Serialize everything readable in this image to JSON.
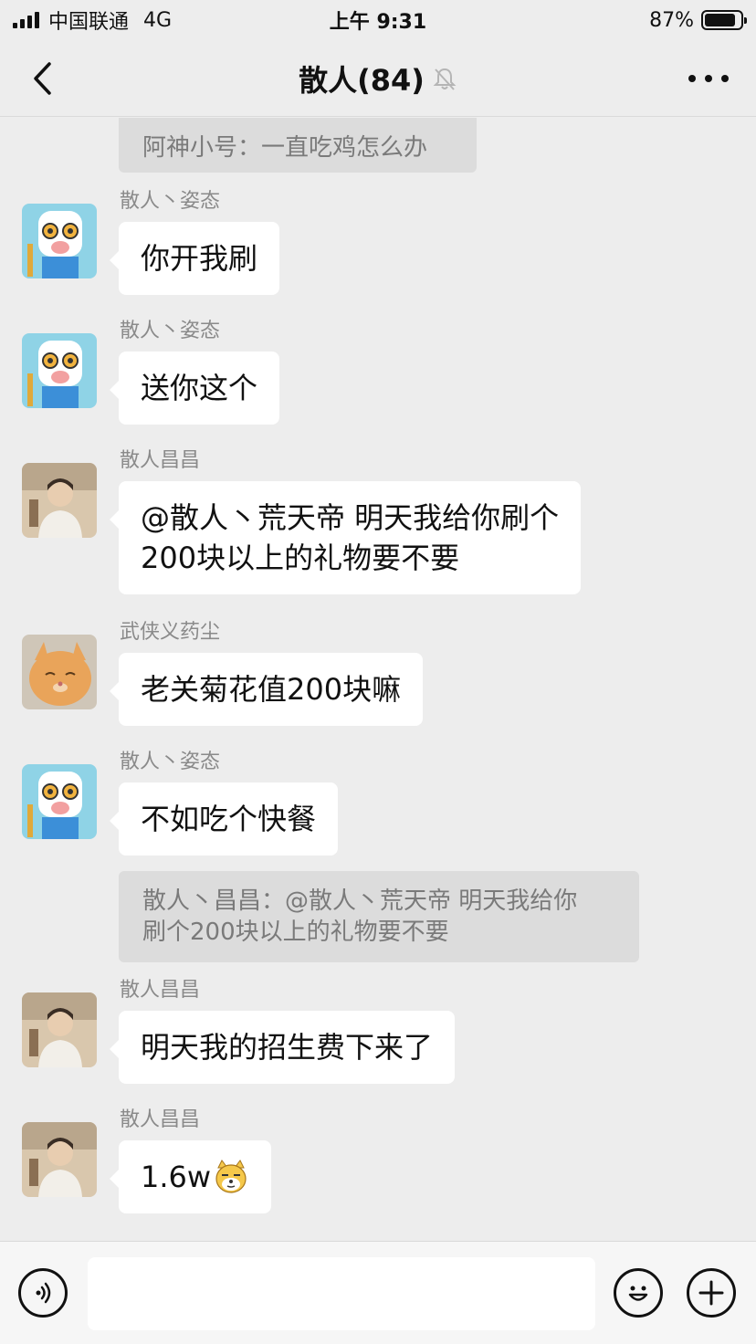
{
  "status_bar": {
    "carrier": "中国联通",
    "network": "4G",
    "time": "上午 9:31",
    "battery_percent": "87%",
    "battery_level": 0.87
  },
  "nav": {
    "title": "散人(84)",
    "muted_icon": "bell-off-icon",
    "back_icon": "chevron-left-icon",
    "more_icon": "more-dots-icon"
  },
  "chat": {
    "top_quote": "阿神小号：一直吃鸡怎么办",
    "messages": [
      {
        "sender": "散人丶姿态",
        "text": "你开我刷"
      },
      {
        "sender": "散人丶姿态",
        "text": "送你这个"
      },
      {
        "sender": "散人昌昌",
        "lines": [
          "@散人丶荒天帝 明天我给你刷个",
          "200块以上的礼物要不要"
        ]
      },
      {
        "sender": "武侠义药尘",
        "text": "老关菊花值200块嘛"
      },
      {
        "sender": "散人丶姿态",
        "text": "不如吃个快餐"
      },
      {
        "sender": "散人昌昌",
        "text": "明天我的招生费下来了"
      },
      {
        "sender": "散人昌昌",
        "text": "1.6w",
        "emoji": "doge-emoji"
      }
    ],
    "quote_reply": {
      "lines": [
        "散人丶昌昌：@散人丶荒天帝 明天我给你",
        "刷个200块以上的礼物要不要"
      ]
    }
  },
  "input_bar": {
    "voice_icon": "voice-icon",
    "emoji_icon": "emoji-icon",
    "plus_icon": "plus-icon",
    "placeholder": ""
  }
}
